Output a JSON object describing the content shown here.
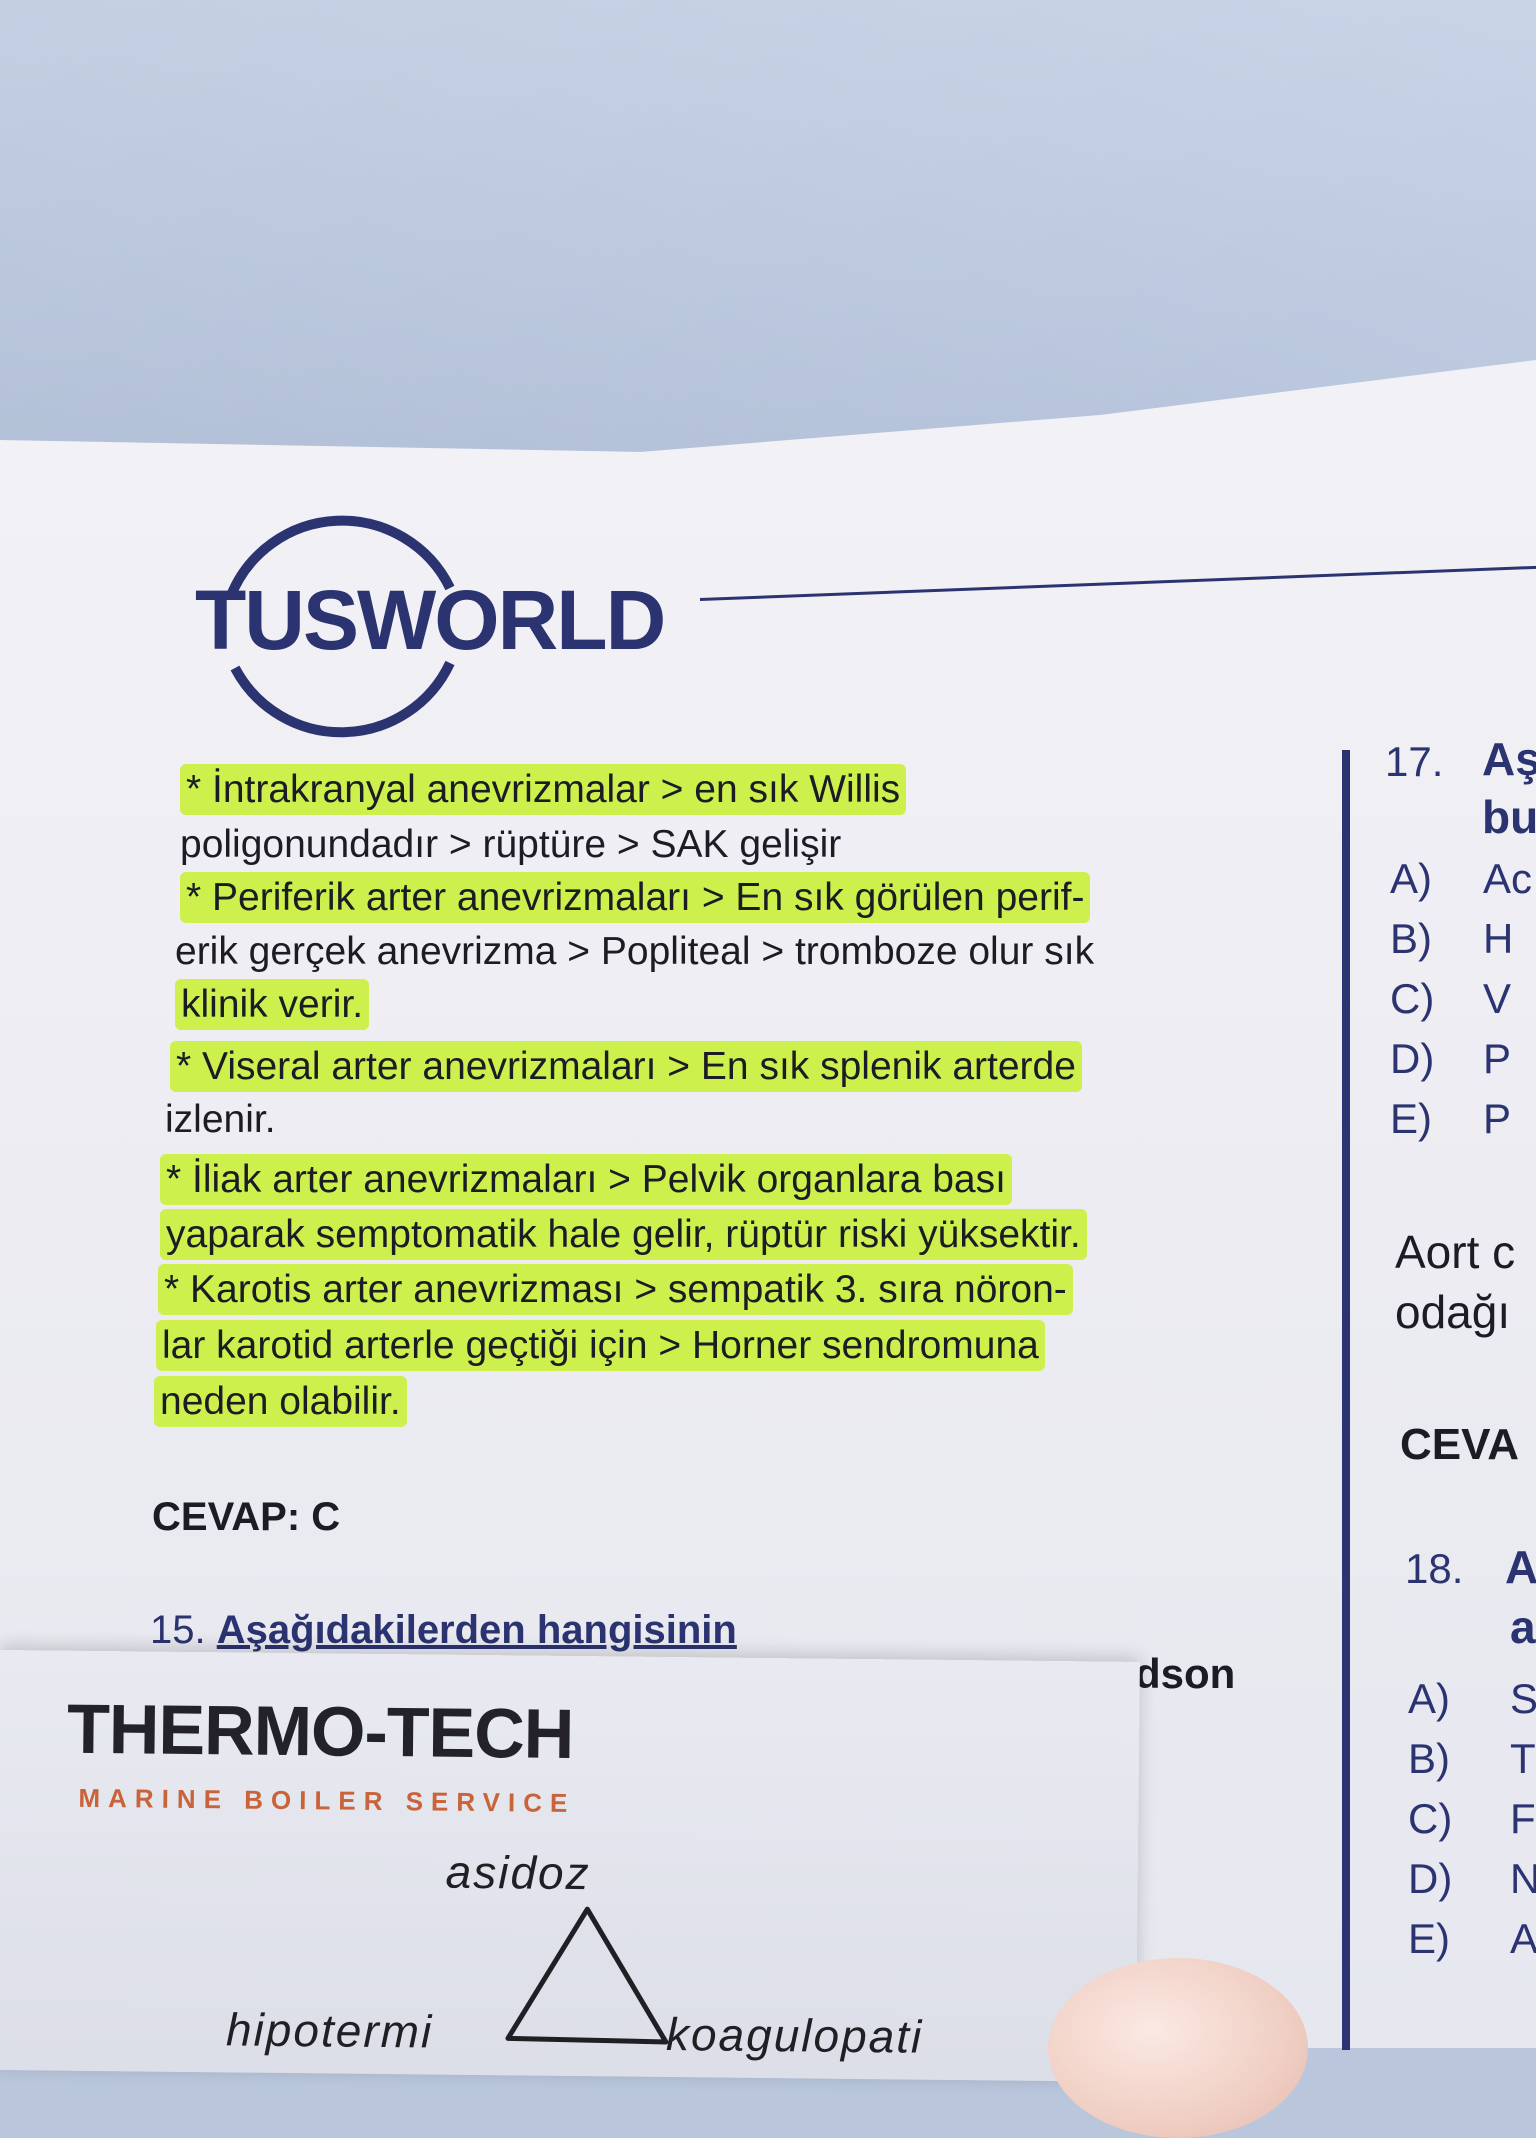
{
  "logo": {
    "text": "TUSWORLD"
  },
  "main_lines": [
    "* İntrakranyal anevrizmalar > en sık Willis",
    "poligonundadır > rüptüre > SAK gelişir",
    "* Periferik arter anevrizmaları > En sık görülen perif-",
    "erik gerçek anevrizma > Popliteal > tromboze olur sık",
    "klinik verir.",
    "* Viseral arter anevrizmaları > En sık splenik arterde",
    "izlenir.",
    "* İliak arter anevrizmaları > Pelvik organlara bası",
    "yaparak semptomatik hale gelir, rüptür riski yüksektir.",
    "* Karotis arter anevrizması > sempatik 3. sıra nöron-",
    "lar karotid arterle geçtiği için > Horner sendromuna",
    "neden olabilir."
  ],
  "answer": "CEVAP: C",
  "question_15": {
    "number": "15.",
    "text": "Aşağıdakilerden hangisinin"
  },
  "partial_word": "dson",
  "right_column": {
    "q17_number": "17.",
    "q17_start": "Aş",
    "q17_line2": "bu",
    "q17_options": [
      {
        "letter": "A)",
        "text": "Ac"
      },
      {
        "letter": "B)",
        "text": "H"
      },
      {
        "letter": "C)",
        "text": "V"
      },
      {
        "letter": "D)",
        "text": "P"
      },
      {
        "letter": "E)",
        "text": "P"
      }
    ],
    "expl_line1": "Aort c",
    "expl_line2": "odağı",
    "answer_partial": "CEVA",
    "q18_number": "18.",
    "q18_start": "A",
    "q18_line2": "a",
    "q18_options": [
      {
        "letter": "A)",
        "text": "S"
      },
      {
        "letter": "B)",
        "text": "T"
      },
      {
        "letter": "C)",
        "text": "F"
      },
      {
        "letter": "D)",
        "text": "N"
      },
      {
        "letter": "E)",
        "text": "A"
      }
    ]
  },
  "card": {
    "title": "THERMO-TECH",
    "subtitle": "MARINE BOILER SERVICE",
    "handwriting_top": "asidoz",
    "handwriting_left": "hipotermi",
    "handwriting_right": "koagulopati"
  },
  "colors": {
    "ink_blue": "#2b3370",
    "highlighter": "#c6f028",
    "card_accent": "#c8633a"
  }
}
